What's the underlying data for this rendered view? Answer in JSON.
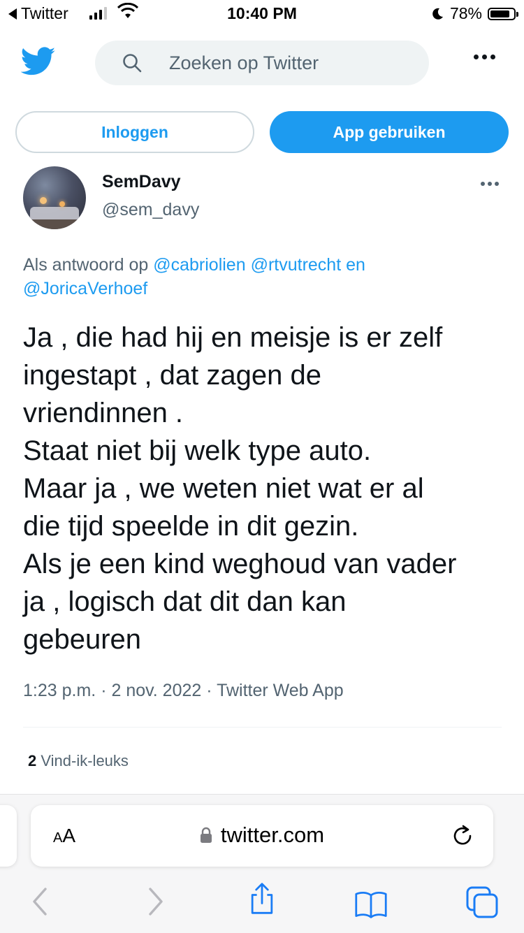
{
  "status_bar": {
    "back_app": "Twitter",
    "time": "10:40 PM",
    "battery": "78%",
    "battery_level": 0.78
  },
  "header": {
    "search_placeholder": "Zoeken op Twitter",
    "login_label": "Inloggen",
    "app_label": "App gebruiken"
  },
  "tweet": {
    "display_name": "SemDavy",
    "handle": "@sem_davy",
    "reply_prefix": "Als antwoord op",
    "mention_1": "@cabriolien",
    "mention_2": "@rtvutrecht",
    "reply_conj": "en",
    "mention_3": "@JoricaVerhoef",
    "text": "Ja , die had hij en meisje is er zelf\ningestapt , dat zagen de\nvriendinnen .\nStaat niet bij welk type auto.\nMaar ja , we weten niet wat er al\ndie tijd speelde in dit gezin.\nAls je een kind weghoud van vader\nja , logisch dat dit dan kan\ngebeuren",
    "time": "1:23 p.m.",
    "date": "2 nov. 2022",
    "source": "Twitter Web App",
    "like_count": "2",
    "like_label": "Vind-ik-leuks"
  },
  "safari": {
    "aa_label": "AA",
    "url": "twitter.com"
  },
  "colors": {
    "brand_blue": "#1d9bf0",
    "secondary_text": "#536471",
    "primary_text": "#0f1419"
  }
}
